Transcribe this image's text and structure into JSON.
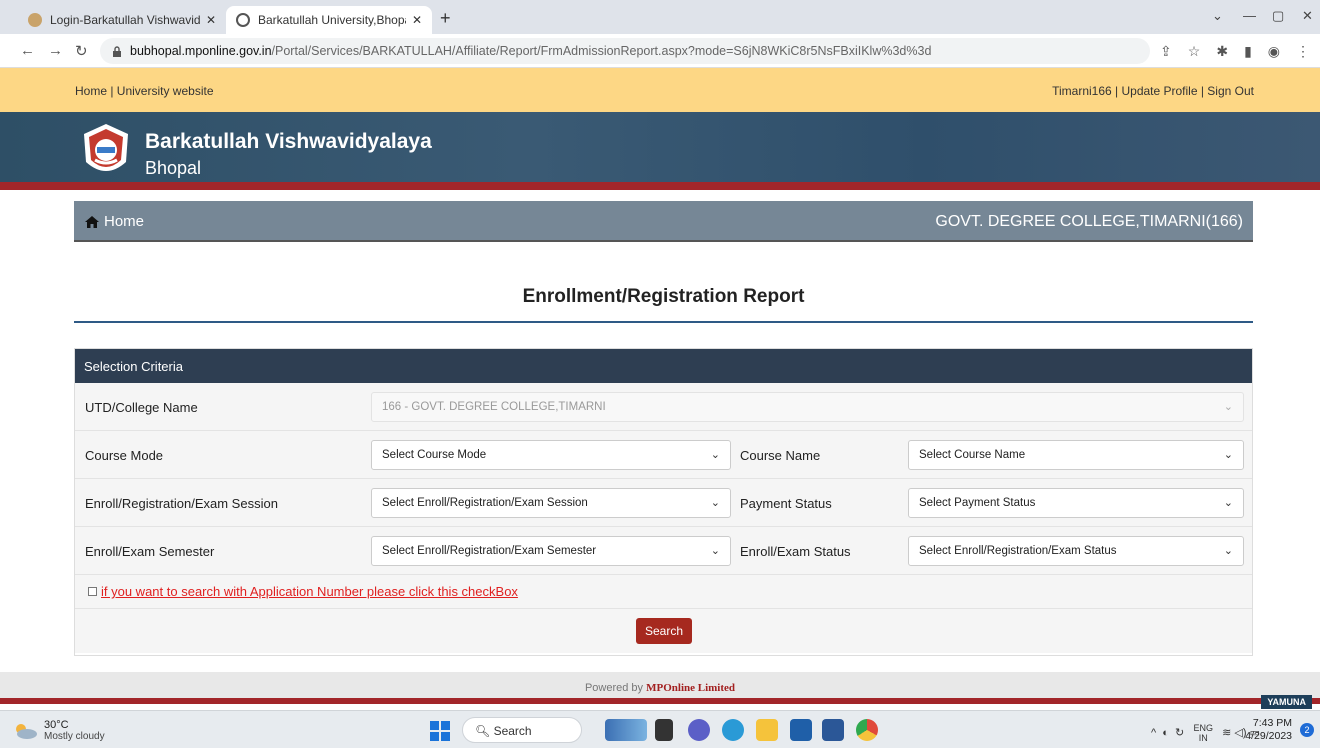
{
  "browser": {
    "tabs": [
      {
        "title": "Login-Barkatullah Vishwavidyalay",
        "active": false
      },
      {
        "title": "Barkatullah University,Bhopal",
        "active": true
      }
    ],
    "new_tab": "+",
    "url_domain": "bubhopal.mponline.gov.in",
    "url_path": "/Portal/Services/BARKATULLAH/Affiliate/Report/FrmAdmissionReport.aspx?mode=S6jN8WKiC8r5NsFBxiIKlw%3d%3d"
  },
  "topbar": {
    "left": "Home | University website",
    "right": "Timarni166 | Update Profile | Sign Out"
  },
  "brand": {
    "name": "Barkatullah Vishwavidyalaya",
    "city": "Bhopal"
  },
  "homebar": {
    "home": "Home",
    "college": "GOVT. DEGREE COLLEGE,TIMARNI(166)"
  },
  "page": {
    "title": "Enrollment/Registration Report"
  },
  "panel": {
    "heading": "Selection Criteria",
    "college_label": "UTD/College Name",
    "college_value": "166 - GOVT. DEGREE COLLEGE,TIMARNI",
    "course_mode_label": "Course Mode",
    "course_mode_value": "Select Course Mode",
    "course_name_label": "Course Name",
    "course_name_value": "Select Course Name",
    "session_label": "Enroll/Registration/Exam Session",
    "session_value": "Select Enroll/Registration/Exam Session",
    "payment_label": "Payment Status",
    "payment_value": "Select Payment Status",
    "semester_label": "Enroll/Exam Semester",
    "semester_value": "Select Enroll/Registration/Exam Semester",
    "status_label": "Enroll/Exam Status",
    "status_value": "Select Enroll/Registration/Exam Status",
    "checkbox_text": "if you want to search with Application Number please click this checkBox",
    "search_button": "Search"
  },
  "footer": {
    "powered_by": "Powered by",
    "company": "MPOnline Limited",
    "badge": "YAMUNA"
  },
  "taskbar": {
    "temp": "30°C",
    "weather": "Mostly cloudy",
    "search": "Search",
    "lang1": "ENG",
    "lang2": "IN",
    "time": "7:43 PM",
    "date": "4/29/2023",
    "notif_count": "2"
  },
  "colors": {
    "accent_red": "#a2262a",
    "panel_head": "#2e3e52",
    "topstrip": "#fdd785"
  }
}
